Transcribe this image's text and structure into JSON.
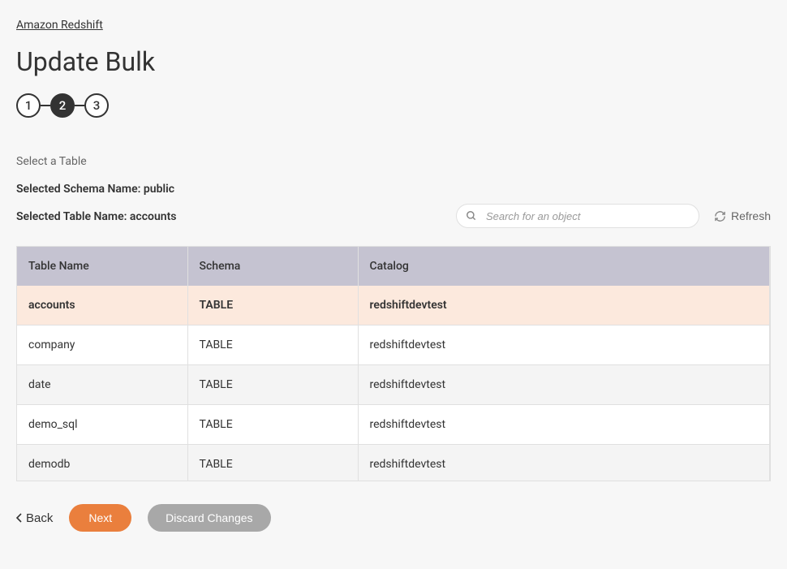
{
  "breadcrumb": {
    "label": "Amazon Redshift"
  },
  "page": {
    "title": "Update Bulk"
  },
  "stepper": {
    "steps": [
      "1",
      "2",
      "3"
    ],
    "active_index": 1
  },
  "section": {
    "select_label": "Select a Table",
    "schema_line": "Selected Schema Name: public",
    "table_line": "Selected Table Name: accounts"
  },
  "search": {
    "placeholder": "Search for an object"
  },
  "refresh": {
    "label": "Refresh"
  },
  "table": {
    "headers": {
      "col1": "Table Name",
      "col2": "Schema",
      "col3": "Catalog"
    },
    "rows": [
      {
        "table_name": "accounts",
        "schema": "TABLE",
        "catalog": "redshiftdevtest",
        "selected": true
      },
      {
        "table_name": "company",
        "schema": "TABLE",
        "catalog": "redshiftdevtest",
        "selected": false
      },
      {
        "table_name": "date",
        "schema": "TABLE",
        "catalog": "redshiftdevtest",
        "selected": false
      },
      {
        "table_name": "demo_sql",
        "schema": "TABLE",
        "catalog": "redshiftdevtest",
        "selected": false
      },
      {
        "table_name": "demodb",
        "schema": "TABLE",
        "catalog": "redshiftdevtest",
        "selected": false
      }
    ]
  },
  "footer": {
    "back_label": "Back",
    "next_label": "Next",
    "discard_label": "Discard Changes"
  }
}
